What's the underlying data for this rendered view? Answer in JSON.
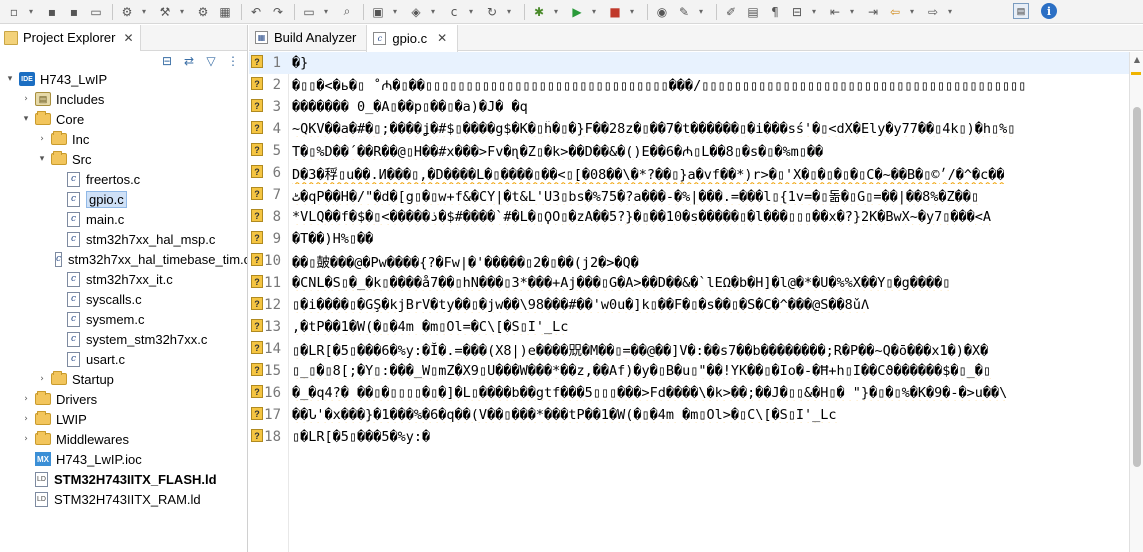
{
  "toolbar": {
    "icons": [
      "new-file-icon",
      "save-icon",
      "save-all-icon",
      "print-icon",
      "build-settings-icon",
      "build-icon",
      "debug-config-icon",
      "binary-icon",
      "undo-icon",
      "redo-icon",
      "terminal-icon",
      "search-icon",
      "project-icon",
      "new-class-icon",
      "new-c-file-icon",
      "refresh-icon",
      "debug-icon",
      "run-icon",
      "stop-icon",
      "external-tools-icon",
      "magic-wand-icon",
      "pen-icon",
      "highlight-icon",
      "pilcrow-icon",
      "annotation-icon",
      "nav-prev-icon",
      "nav-next-icon",
      "back-icon",
      "forward-icon"
    ]
  },
  "project_explorer": {
    "title": "Project Explorer",
    "close_glyph": "✕",
    "tree": [
      {
        "label": "H743_LwIP",
        "type": "project",
        "depth": 0,
        "expanded": true
      },
      {
        "label": "Includes",
        "type": "includes",
        "depth": 1,
        "expanded": false
      },
      {
        "label": "Core",
        "type": "folder",
        "depth": 1,
        "expanded": true
      },
      {
        "label": "Inc",
        "type": "folder",
        "depth": 2,
        "expanded": false
      },
      {
        "label": "Src",
        "type": "folder",
        "depth": 2,
        "expanded": true
      },
      {
        "label": "freertos.c",
        "type": "cfile",
        "depth": 3
      },
      {
        "label": "gpio.c",
        "type": "cfile",
        "depth": 3,
        "selected": true
      },
      {
        "label": "main.c",
        "type": "cfile",
        "depth": 3
      },
      {
        "label": "stm32h7xx_hal_msp.c",
        "type": "cfile",
        "depth": 3
      },
      {
        "label": "stm32h7xx_hal_timebase_tim.c",
        "type": "cfile",
        "depth": 3
      },
      {
        "label": "stm32h7xx_it.c",
        "type": "cfile",
        "depth": 3
      },
      {
        "label": "syscalls.c",
        "type": "cfile",
        "depth": 3
      },
      {
        "label": "sysmem.c",
        "type": "cfile",
        "depth": 3
      },
      {
        "label": "system_stm32h7xx.c",
        "type": "cfile",
        "depth": 3
      },
      {
        "label": "usart.c",
        "type": "cfile",
        "depth": 3
      },
      {
        "label": "Startup",
        "type": "folder",
        "depth": 2,
        "expanded": false
      },
      {
        "label": "Drivers",
        "type": "folder",
        "depth": 1,
        "expanded": false
      },
      {
        "label": "LWIP",
        "type": "folder",
        "depth": 1,
        "expanded": false
      },
      {
        "label": "Middlewares",
        "type": "folder",
        "depth": 1,
        "expanded": false
      },
      {
        "label": "H743_LwIP.ioc",
        "type": "mx",
        "depth": 1
      },
      {
        "label": "STM32H743IITX_FLASH.ld",
        "type": "ld",
        "depth": 1,
        "bold": true
      },
      {
        "label": "STM32H743IITX_RAM.ld",
        "type": "ld",
        "depth": 1
      }
    ]
  },
  "editor": {
    "tabs": [
      {
        "label": "Build Analyzer",
        "active": false
      },
      {
        "label": "gpio.c",
        "active": true,
        "close_glyph": "✕"
      }
    ],
    "lines": [
      {
        "n": "1",
        "text": "�}"
      },
      {
        "n": "2",
        "text": "�▯▯�<�ь�▯ ˚₼�▯��▯▯▯▯▯▯▯▯▯▯▯▯▯▯▯▯▯▯▯▯▯▯▯▯▯▯▯▯▯▯���/▯▯▯▯▯▯▯▯▯▯▯▯▯▯▯▯▯▯▯▯▯▯▯▯▯▯▯▯▯▯▯▯▯▯▯▯▯▯▯▯"
      },
      {
        "n": "3",
        "text": "������� 0_�A▯��p▯��▯�a)�J� �q"
      },
      {
        "n": "4",
        "text": "~QKV��a�#�▯;����ʝ�#$▯����g$�K�▯h̃�▯�}F��28z�▯��7�t������▯�i���sś'�▯<dX�Ely�y77��▯4k▯)�h▯%▯"
      },
      {
        "n": "5",
        "text": "T�▯%D��´��R��@▯H��#x���>Fv�ɳ�Z▯�k>��D��&�()E��6�₼▯L��8▯�s�▯�%m▯��"
      },
      {
        "n": "6",
        "text": "D�3�稃▯u��.И���▯,�D����L�▯����▯��<▯[�08��\\�*?��▯}a�vf��*)r>�▯'X�▯�▯�▯�▯C�~��B�▯©׳/�^�c��"
      },
      {
        "n": "7",
        "text": "ٹ�qP��H�/\"�d�[g▯�▯w+f&�CY|�t&L'U3▯bs�%75�?a���-�%|���.=���l▯{1v=�▯돎�▯G▯=��|��8%�Z��▯"
      },
      {
        "n": "8",
        "text": "*VLQ��f�$�▯<�����ذ�$#����`#�L�▯ϘO▯�zA��5?}�▯��10�s�����▯�l���▯▯▯��x�?}2K�BwX~�y7▯���<A"
      },
      {
        "n": "9",
        "text": "�T��)H%▯��"
      },
      {
        "n": "10",
        "text": "��▯皷���@�Pw����{?�Fw|�'�����▯2�▯��(j2�>�Q�"
      },
      {
        "n": "11",
        "text": "�CNL�S▯�_�k▯����å7��▯hN���▯3*���+Aj���▯G�A>��D��&�`lEΩ�b�H]�l@�*�U�%%X��Y▯�g����▯"
      },
      {
        "n": "12",
        "text": "▯�i����▯�GŞ�kjBrV�ty��▯�jw��\\98���#��'w0u�]k▯��F�▯�s��▯�S�C�^���@S��8ǔΛ"
      },
      {
        "n": "13",
        "text": ",�tP��1�W(�▯�4m �m▯Ol=�C\\[�S▯I'_Lc"
      },
      {
        "n": "14",
        "text": "▯�LR[�5▯���6�%y:�Ĭ�.=���(X8|)e����㒭�M��▯=��@��]V�:��s7��b��������;R�P��~Q�ō���x1�)�X�"
      },
      {
        "n": "15",
        "text": "▯_▯�▯8[;�Y▯:���_W▯mZ�X9▯U���W���*��z,��Af)�y�▯B�u▯\"��!YK��▯�Io�-�Ħ+h▯I��Cϑ������$�▯_�▯"
      },
      {
        "n": "16",
        "text": "�_�q4?� ��▯�▯▯▯▯�▯�]�L▯����b��gtf���5▯▯▯���>Fd����\\�k>��;��J�▯▯&�H▯� \"}�▯�▯%�K�9�-�>u��\\"
      },
      {
        "n": "17",
        "text": "��Ն'�x���}�1���%�6�q��(V��▯���*���tP��1�W(�▯�4m �m▯Ol>�▯C\\[�S▯I'_Lc"
      },
      {
        "n": "18",
        "text": "▯�LR[�5▯���5�%y:�"
      }
    ]
  }
}
